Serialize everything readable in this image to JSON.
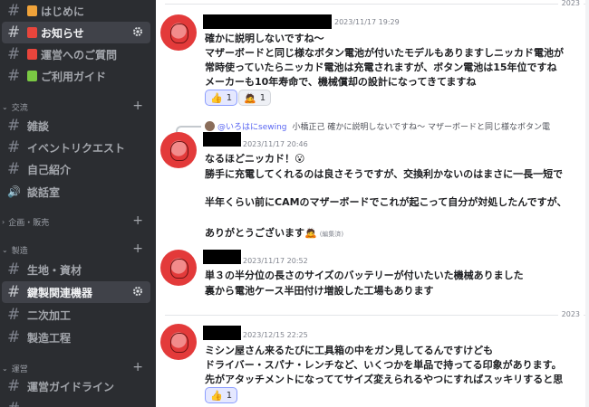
{
  "sidebar": {
    "channels_top": [
      {
        "label": "はじめに",
        "emoji_color": "#f0a33a"
      },
      {
        "label": "お知らせ",
        "emoji_color": "#e8453c",
        "selected": true
      },
      {
        "label": "運営へのご質問",
        "emoji_color": "#e8453c"
      },
      {
        "label": "ご利用ガイド",
        "emoji_color": "#7ac943"
      }
    ],
    "cat_koryu": "交流",
    "koryu": [
      {
        "label": "雑談"
      },
      {
        "label": "イベントリクエスト"
      },
      {
        "label": "自己紹介"
      },
      {
        "label": "談話室",
        "voice": true
      }
    ],
    "cat_kikaku": "企画・販売",
    "cat_seizo": "製造",
    "seizo": [
      {
        "label": "生地・資材"
      },
      {
        "label": "鍵製関連機器",
        "selected": true
      },
      {
        "label": "二次加工"
      },
      {
        "label": "製造工程"
      }
    ],
    "cat_unei": "運営",
    "unei": [
      {
        "label": "運営ガイドライン"
      }
    ]
  },
  "messages": [
    {
      "timestamp": "2023/11/17 19:29",
      "lines": [
        "確かに説明しないですね〜",
        "マザーボードと同じ様なボタン電池が付いたモデルもありますしニッカド電池が",
        "常時使っていたらニッカド電池は充電されますが、ボタン電池は15年位ですね",
        "メーカーも10年寿命で、機械償却の設計になってきてますね"
      ],
      "reactions": [
        {
          "emoji": "👍",
          "count": "1"
        },
        {
          "emoji": "🙇",
          "count": "1"
        }
      ]
    },
    {
      "reply_author": "@いろはにsewing",
      "reply_text": "小橋正己 確かに説明しないですね〜 マザーボードと同じ様なボタン電",
      "timestamp": "2023/11/17 20:46",
      "lines": [
        "なるほどニッカド！😮",
        "勝手に充電してくれるのは良さそうですが、交換利かないのはまさに一長一短で",
        "",
        "半年くらい前にCAMのマザーボードでこれが起こって自分が対処したんですが、",
        "",
        "ありがとうございます🙇"
      ],
      "edited": "(編集済)"
    },
    {
      "timestamp": "2023/11/17 20:52",
      "lines": [
        "単３の半分位の長さのサイズのバッテリーが付いたいた機械ありました",
        "裏から電池ケース半田付け増設した工場もあります"
      ]
    },
    {
      "timestamp": "2023/12/15 22:25",
      "lines": [
        "ミシン屋さん来るたびに工具箱の中をガン見してるんですけども",
        "ドライバー・スパナ・レンチなど、いくつかを単品で持ってる印象があります。",
        "先がアタッチメントになっててサイズ変えられるやつにすればスッキリすると思"
      ],
      "reactions": [
        {
          "emoji": "👍",
          "count": "1"
        }
      ]
    }
  ],
  "dividers": {
    "top": "2023",
    "mid": "2023"
  },
  "colors": {
    "sidebar_bg": "#2b2d31",
    "selected_bg": "#404249",
    "avatar_red": "#e33a3a"
  }
}
